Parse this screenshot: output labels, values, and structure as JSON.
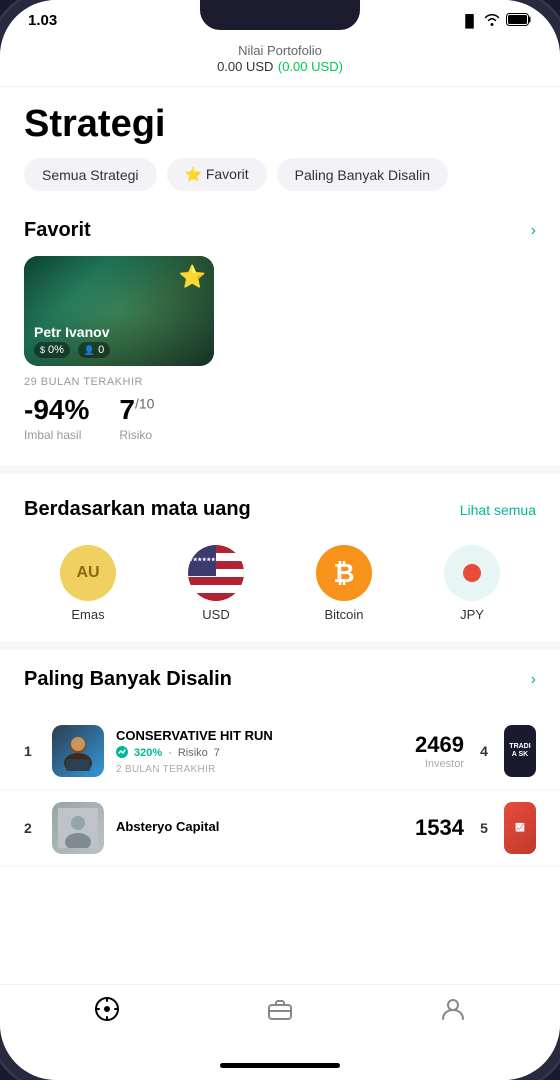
{
  "status_bar": {
    "time": "1.03",
    "location_icon": "▸",
    "signal": "▐▌",
    "wifi": "wifi",
    "battery": "🔋"
  },
  "header": {
    "portfolio_label": "Nilai Portofolio",
    "portfolio_value": "0.00 USD",
    "portfolio_change": "(0.00 USD)"
  },
  "page": {
    "title": "Strategi"
  },
  "filter_tabs": [
    {
      "id": "semua",
      "label": "Semua Strategi"
    },
    {
      "id": "favorit",
      "label": "⭐ Favorit"
    },
    {
      "id": "paling",
      "label": "Paling Banyak Disalin"
    }
  ],
  "favorit_section": {
    "title": "Favorit",
    "arrow": "›",
    "card": {
      "name": "Petr Ivanov",
      "profit_pct": "0%",
      "subscribers": "0",
      "period": "29 BULAN TERAKHIR",
      "return_value": "-94%",
      "return_label": "Imbal hasil",
      "risk_value": "7",
      "risk_max": "/10",
      "risk_label": "Risiko"
    }
  },
  "currency_section": {
    "title": "Berdasarkan mata uang",
    "link": "Lihat semua",
    "items": [
      {
        "id": "emas",
        "label": "Emas",
        "symbol": "AU",
        "type": "gold"
      },
      {
        "id": "usd",
        "label": "USD",
        "symbol": "USD",
        "type": "usd"
      },
      {
        "id": "btc",
        "label": "Bitcoin",
        "symbol": "₿",
        "type": "btc"
      },
      {
        "id": "jpy",
        "label": "JPY",
        "symbol": "●",
        "type": "jpy"
      }
    ]
  },
  "disalin_section": {
    "title": "Paling Banyak Disalin",
    "arrow": "›",
    "items": [
      {
        "rank": "1",
        "rank_right": "4",
        "name": "CONSERVATIVE HIT RUN",
        "return_pct": "320%",
        "risk": "7",
        "period": "2 BULAN TERAKHIR",
        "investor_count": "2469",
        "investor_label": "Investor",
        "card_text": "TRADI A SK"
      },
      {
        "rank": "2",
        "rank_right": "5",
        "name": "Absteryo Capital",
        "return_pct": "",
        "risk": "",
        "period": "",
        "investor_count": "1534",
        "investor_label": "",
        "card_text": ""
      }
    ]
  },
  "bottom_nav": {
    "items": [
      {
        "id": "explore",
        "icon": "◎",
        "label": ""
      },
      {
        "id": "briefcase",
        "icon": "💼",
        "label": ""
      },
      {
        "id": "profile",
        "icon": "👤",
        "label": ""
      }
    ]
  }
}
